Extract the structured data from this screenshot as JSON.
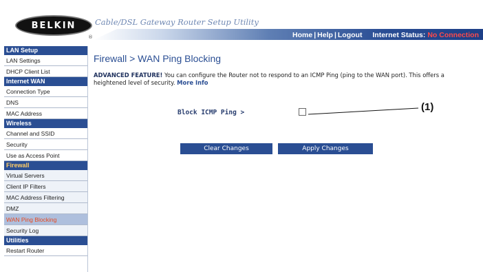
{
  "header": {
    "logo": "BELKIN",
    "logo_mark": "®",
    "utility_title": "Cable/DSL Gateway Router Setup Utility",
    "nav": {
      "home": "Home",
      "help": "Help",
      "logout": "Logout",
      "separator": "|"
    },
    "internet_status_label": "Internet Status:",
    "internet_status_value": "No Connection",
    "status_color": "#ff4a4a"
  },
  "sidebar": {
    "sections": [
      {
        "title": "LAN Setup",
        "items": [
          "LAN Settings",
          "DHCP Client List"
        ]
      },
      {
        "title": "Internet WAN",
        "items": [
          "Connection Type",
          "DNS",
          "MAC Address"
        ]
      },
      {
        "title": "Wireless",
        "items": [
          "Channel and SSID",
          "Security",
          "Use as Access Point"
        ]
      },
      {
        "title": "Firewall",
        "items": [
          "Virtual Servers",
          "Client IP Filters",
          "MAC Address Filtering",
          "DMZ",
          "WAN Ping Blocking",
          "Security Log"
        ]
      },
      {
        "title": "Utilities",
        "items": [
          "Restart Router"
        ]
      }
    ],
    "active_section": "Firewall",
    "active_item": "WAN Ping Blocking"
  },
  "main": {
    "title": "Firewall > WAN Ping Blocking",
    "advanced_label": "ADVANCED FEATURE!",
    "description": " You can configure the Router not to respond to an ICMP Ping (ping to the WAN port). This offers a heightened level of security. ",
    "more_info": "More Info",
    "block_label": "Block ICMP Ping >",
    "block_checked": false,
    "callout": "(1)",
    "buttons": {
      "clear": "Clear Changes",
      "apply": "Apply Changes"
    }
  },
  "colors": {
    "brand_blue": "#2a4e93",
    "active_item_text": "#e8481e",
    "active_item_bg": "#aebfdd"
  }
}
